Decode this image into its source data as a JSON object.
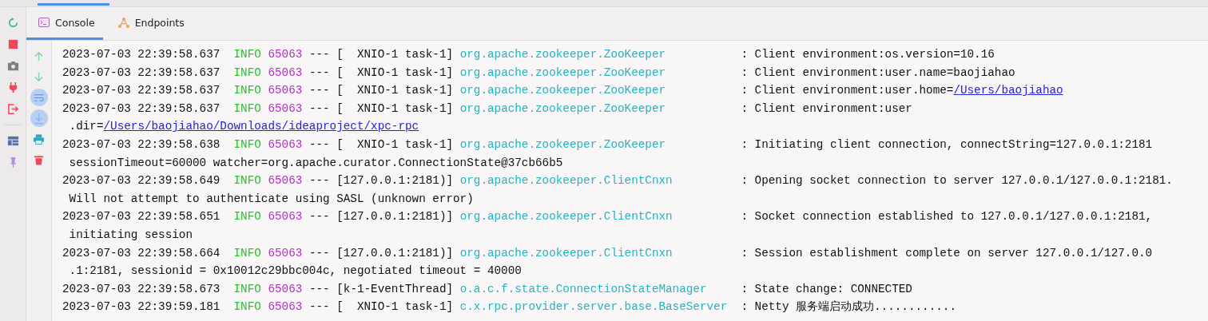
{
  "tabs": [
    {
      "label": "Console",
      "selected": true,
      "kind": "console"
    },
    {
      "label": "Endpoints",
      "selected": false,
      "kind": "endpoints"
    }
  ],
  "log": [
    {
      "timestamp": "2023-07-03 22:39:58.637",
      "level": "INFO",
      "pid": "65063",
      "separator": "---",
      "thread": "[  XNIO-1 task-1]",
      "logger": "org.apache.zookeeper.ZooKeeper",
      "message": ": Client environment:os.version=10.16"
    },
    {
      "timestamp": "2023-07-03 22:39:58.637",
      "level": "INFO",
      "pid": "65063",
      "separator": "---",
      "thread": "[  XNIO-1 task-1]",
      "logger": "org.apache.zookeeper.ZooKeeper",
      "message": ": Client environment:user.name=baojiahao"
    },
    {
      "timestamp": "2023-07-03 22:39:58.637",
      "level": "INFO",
      "pid": "65063",
      "separator": "---",
      "thread": "[  XNIO-1 task-1]",
      "logger": "org.apache.zookeeper.ZooKeeper",
      "message": ": Client environment:user.home=",
      "message_link": "/Users/baojiahao"
    },
    {
      "timestamp": "2023-07-03 22:39:58.637",
      "level": "INFO",
      "pid": "65063",
      "separator": "---",
      "thread": "[  XNIO-1 task-1]",
      "logger": "org.apache.zookeeper.ZooKeeper",
      "message": ": Client environment:user",
      "continuation": ".dir=",
      "continuation_link": "/Users/baojiahao/Downloads/ideaproject/xpc-rpc"
    },
    {
      "timestamp": "2023-07-03 22:39:58.638",
      "level": "INFO",
      "pid": "65063",
      "separator": "---",
      "thread": "[  XNIO-1 task-1]",
      "logger": "org.apache.zookeeper.ZooKeeper",
      "message": ": Initiating client connection, connectString=127.0.0.1:2181",
      "continuation": "sessionTimeout=60000 watcher=org.apache.curator.ConnectionState@37cb66b5"
    },
    {
      "timestamp": "2023-07-03 22:39:58.649",
      "level": "INFO",
      "pid": "65063",
      "separator": "---",
      "thread": "[127.0.0.1:2181)]",
      "logger": "org.apache.zookeeper.ClientCnxn",
      "message": ": Opening socket connection to server 127.0.0.1/127.0.0.1:2181.",
      "continuation": "Will not attempt to authenticate using SASL (unknown error)"
    },
    {
      "timestamp": "2023-07-03 22:39:58.651",
      "level": "INFO",
      "pid": "65063",
      "separator": "---",
      "thread": "[127.0.0.1:2181)]",
      "logger": "org.apache.zookeeper.ClientCnxn",
      "message": ": Socket connection established to 127.0.0.1/127.0.0.1:2181,",
      "continuation": "initiating session"
    },
    {
      "timestamp": "2023-07-03 22:39:58.664",
      "level": "INFO",
      "pid": "65063",
      "separator": "---",
      "thread": "[127.0.0.1:2181)]",
      "logger": "org.apache.zookeeper.ClientCnxn",
      "message": ": Session establishment complete on server 127.0.0.1/127.0.0",
      "continuation": ".1:2181, sessionid = 0x10012c29bbc004c, negotiated timeout = 40000"
    },
    {
      "timestamp": "2023-07-03 22:39:58.673",
      "level": "INFO",
      "pid": "65063",
      "separator": "---",
      "thread": "[k-1-EventThread]",
      "logger": "o.a.c.f.state.ConnectionStateManager",
      "message": ": State change: CONNECTED"
    },
    {
      "timestamp": "2023-07-03 22:39:59.181",
      "level": "INFO",
      "pid": "65063",
      "separator": "---",
      "thread": "[  XNIO-1 task-1]",
      "logger": "c.x.rpc.provider.server.base.BaseServer",
      "message": ": Netty 服务端启动成功............"
    }
  ],
  "console_actions": [
    {
      "kind": "up",
      "selected": false
    },
    {
      "kind": "down",
      "selected": false
    },
    {
      "kind": "wrap",
      "selected": true
    },
    {
      "kind": "scroll",
      "selected": true
    },
    {
      "kind": "print",
      "selected": false
    },
    {
      "kind": "clear",
      "selected": false
    }
  ]
}
